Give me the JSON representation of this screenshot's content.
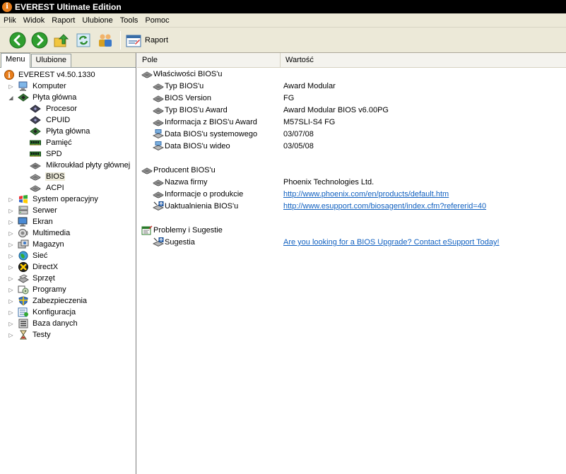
{
  "window": {
    "title": "EVEREST Ultimate Edition",
    "app_icon_glyph": "i"
  },
  "menubar": {
    "items": [
      "Plik",
      "Widok",
      "Raport",
      "Ulubione",
      "Tools",
      "Pomoc"
    ]
  },
  "toolbar": {
    "buttons": [
      {
        "icon": "back-arrow-icon"
      },
      {
        "icon": "forward-arrow-icon"
      },
      {
        "icon": "up-folder-icon"
      },
      {
        "icon": "refresh-icon"
      },
      {
        "icon": "users-icon"
      }
    ],
    "raport_label": "Raport"
  },
  "left_panel": {
    "tabs": [
      "Menu",
      "Ulubione"
    ],
    "active_tab": "Menu",
    "tree": [
      {
        "label": "EVEREST v4.50.1330",
        "icon": "everest-info-icon",
        "level": 0,
        "expander": "none"
      },
      {
        "label": "Komputer",
        "icon": "computer-icon",
        "level": 1,
        "expander": "collapsed"
      },
      {
        "label": "Płyta główna",
        "icon": "motherboard-icon",
        "level": 1,
        "expander": "expanded"
      },
      {
        "label": "Procesor",
        "icon": "cpu-icon",
        "level": 2,
        "expander": "none"
      },
      {
        "label": "CPUID",
        "icon": "cpu-icon",
        "level": 2,
        "expander": "none"
      },
      {
        "label": "Płyta główna",
        "icon": "motherboard-icon",
        "level": 2,
        "expander": "none"
      },
      {
        "label": "Pamięć",
        "icon": "memory-icon",
        "level": 2,
        "expander": "none"
      },
      {
        "label": "SPD",
        "icon": "memory-icon",
        "level": 2,
        "expander": "none"
      },
      {
        "label": "Mikroukład płyty głównej",
        "icon": "chipset-icon",
        "level": 2,
        "expander": "none"
      },
      {
        "label": "BIOS",
        "icon": "bios-chip-icon",
        "level": 2,
        "expander": "none",
        "selected": true
      },
      {
        "label": "ACPI",
        "icon": "bios-chip-icon",
        "level": 2,
        "expander": "none"
      },
      {
        "label": "System operacyjny",
        "icon": "windows-icon",
        "level": 1,
        "expander": "collapsed"
      },
      {
        "label": "Serwer",
        "icon": "server-icon",
        "level": 1,
        "expander": "collapsed"
      },
      {
        "label": "Ekran",
        "icon": "monitor-icon",
        "level": 1,
        "expander": "collapsed"
      },
      {
        "label": "Multimedia",
        "icon": "speaker-icon",
        "level": 1,
        "expander": "collapsed"
      },
      {
        "label": "Magazyn",
        "icon": "storage-icon",
        "level": 1,
        "expander": "collapsed"
      },
      {
        "label": "Sieć",
        "icon": "network-globe-icon",
        "level": 1,
        "expander": "collapsed"
      },
      {
        "label": "DirectX",
        "icon": "directx-icon",
        "level": 1,
        "expander": "collapsed"
      },
      {
        "label": "Sprzęt",
        "icon": "devices-icon",
        "level": 1,
        "expander": "collapsed"
      },
      {
        "label": "Programy",
        "icon": "programs-icon",
        "level": 1,
        "expander": "collapsed"
      },
      {
        "label": "Zabezpieczenia",
        "icon": "security-shield-icon",
        "level": 1,
        "expander": "collapsed"
      },
      {
        "label": "Konfiguracja",
        "icon": "configuration-icon",
        "level": 1,
        "expander": "collapsed"
      },
      {
        "label": "Baza danych",
        "icon": "database-icon",
        "level": 1,
        "expander": "collapsed"
      },
      {
        "label": "Testy",
        "icon": "hourglass-icon",
        "level": 1,
        "expander": "collapsed"
      }
    ]
  },
  "right_panel": {
    "columns": [
      "Pole",
      "Wartość"
    ],
    "rows": [
      {
        "kind": "group",
        "field": "Właściwości BIOS'u",
        "icon": "bios-chip-icon"
      },
      {
        "kind": "item",
        "field": "Typ BIOS'u",
        "value": "Award Modular",
        "icon": "bios-chip-icon"
      },
      {
        "kind": "item",
        "field": "BIOS Version",
        "value": "FG",
        "icon": "bios-chip-icon"
      },
      {
        "kind": "item",
        "field": "Typ BIOS'u Award",
        "value": "Award Modular BIOS v6.00PG",
        "icon": "bios-chip-icon"
      },
      {
        "kind": "item",
        "field": "Informacja z BIOS'u Award",
        "value": "M57SLI-S4 FG",
        "icon": "bios-chip-icon"
      },
      {
        "kind": "item",
        "field": "Data BIOS'u systemowego",
        "value": "03/07/08",
        "icon": "calendar-date-icon"
      },
      {
        "kind": "item",
        "field": "Data BIOS'u wideo",
        "value": "03/05/08",
        "icon": "calendar-date-icon"
      },
      {
        "kind": "spacer"
      },
      {
        "kind": "group",
        "field": "Producent BIOS'u",
        "icon": "bios-chip-icon"
      },
      {
        "kind": "item",
        "field": "Nazwa firmy",
        "value": "Phoenix Technologies Ltd.",
        "icon": "bios-chip-icon"
      },
      {
        "kind": "item",
        "field": "Informacje o produkcie",
        "value": "http://www.phoenix.com/en/products/default.htm",
        "icon": "bios-chip-icon",
        "link": true
      },
      {
        "kind": "item",
        "field": "Uaktualnienia BIOS'u",
        "value": "http://www.esupport.com/biosagent/index.cfm?refererid=40",
        "icon": "bios-update-icon",
        "link": true
      },
      {
        "kind": "spacer"
      },
      {
        "kind": "group",
        "field": "Problemy i Sugestie",
        "icon": "suggestions-icon"
      },
      {
        "kind": "item",
        "field": "Sugestia",
        "value": "Are you looking for a BIOS Upgrade?  Contact eSupport Today!",
        "icon": "bios-update-icon",
        "link": true
      }
    ]
  },
  "colors": {
    "link": "#1060c0",
    "chrome": "#ece9d8",
    "titlebar": "#000000"
  }
}
